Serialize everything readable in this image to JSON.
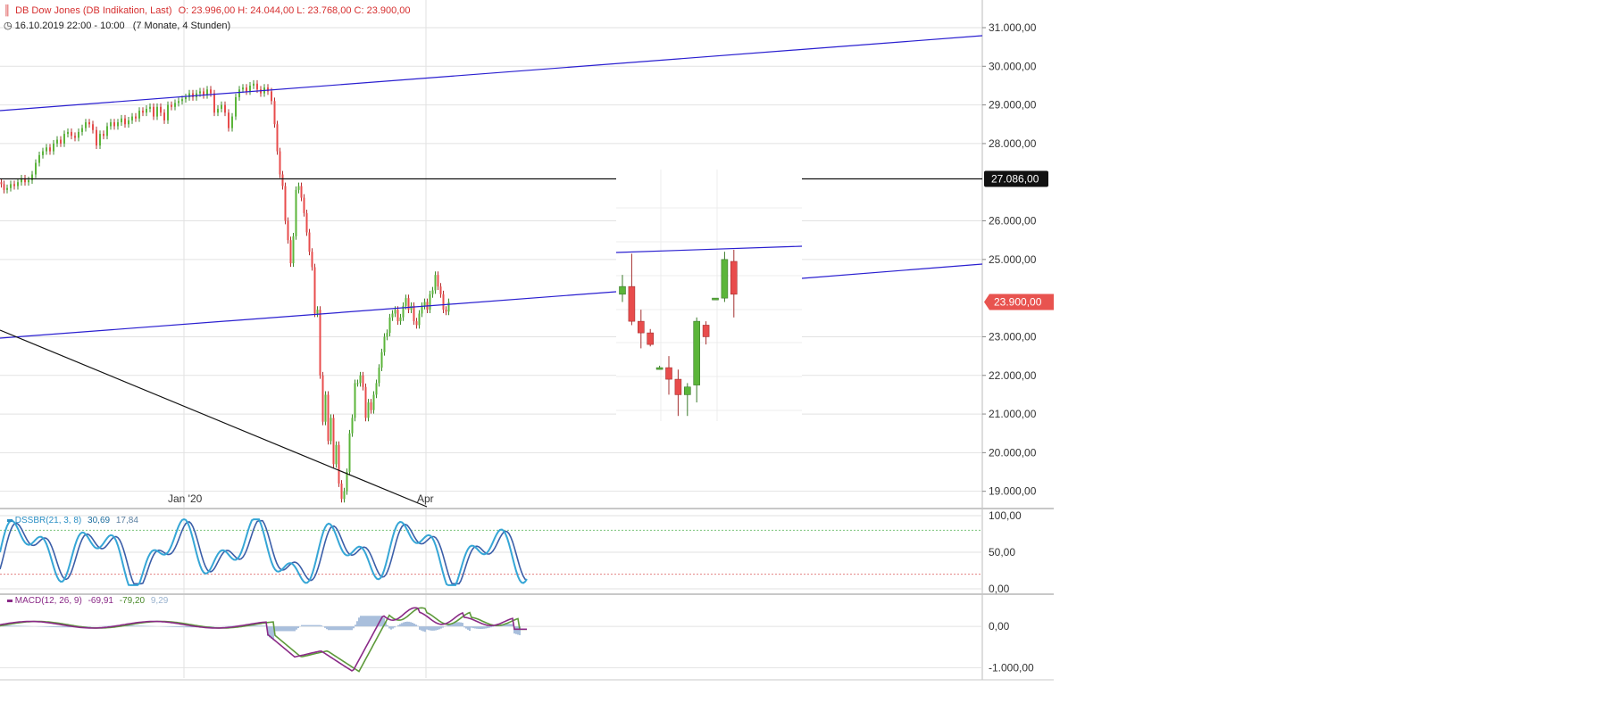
{
  "header": {
    "title": "DB Dow Jones (DB Indikation, Last)",
    "ohlc": "O: 23.996,00   H: 24.044,00   L: 23.768,00   C: 23.900,00",
    "period": "16.10.2019 22:00 - 10:00",
    "range": "(7 Monate, 4 Stunden)"
  },
  "colors": {
    "up": "#5bb53a",
    "down": "#e84c4c",
    "trend": "#2a1fd0",
    "grid": "#e2e2e2",
    "axis": "#333333",
    "last_badge": "#e8534f"
  },
  "icons": [
    "candles-icon",
    "clock-icon"
  ],
  "chart_data": [
    {
      "type": "candlestick",
      "name": "main",
      "x_ticks": [
        "Jan '20",
        "Apr"
      ],
      "y_ticks": [
        "31.000,00",
        "30.000,00",
        "29.000,00",
        "28.000,00",
        "27.086,00",
        "26.000,00",
        "25.000,00",
        "23.900,00",
        "23.000,00",
        "22.000,00",
        "21.000,00",
        "20.000,00",
        "19.000,00"
      ],
      "ylim": [
        18600,
        31300
      ],
      "series_path": [
        [
          0,
          27000
        ],
        [
          3,
          26950
        ],
        [
          6,
          26800
        ],
        [
          10,
          26850
        ],
        [
          14,
          26950
        ],
        [
          18,
          26900
        ],
        [
          22,
          27000
        ],
        [
          26,
          27100
        ],
        [
          30,
          27000
        ],
        [
          34,
          27050
        ],
        [
          38,
          27200
        ],
        [
          42,
          27500
        ],
        [
          46,
          27700
        ],
        [
          50,
          27800
        ],
        [
          54,
          27900
        ],
        [
          58,
          27800
        ],
        [
          62,
          28000
        ],
        [
          66,
          28100
        ],
        [
          70,
          28000
        ],
        [
          74,
          28250
        ],
        [
          78,
          28300
        ],
        [
          82,
          28200
        ],
        [
          86,
          28150
        ],
        [
          90,
          28300
        ],
        [
          94,
          28400
        ],
        [
          98,
          28550
        ],
        [
          102,
          28500
        ],
        [
          106,
          28350
        ],
        [
          110,
          27950
        ],
        [
          114,
          28250
        ],
        [
          118,
          28200
        ],
        [
          122,
          28450
        ],
        [
          126,
          28550
        ],
        [
          130,
          28450
        ],
        [
          134,
          28550
        ],
        [
          138,
          28650
        ],
        [
          142,
          28500
        ],
        [
          146,
          28600
        ],
        [
          150,
          28700
        ],
        [
          154,
          28650
        ],
        [
          158,
          28850
        ],
        [
          162,
          28800
        ],
        [
          166,
          28900
        ],
        [
          170,
          28950
        ],
        [
          174,
          28700
        ],
        [
          178,
          28950
        ],
        [
          182,
          28800
        ],
        [
          186,
          28600
        ],
        [
          190,
          29000
        ],
        [
          194,
          28950
        ],
        [
          198,
          29050
        ],
        [
          202,
          29100
        ],
        [
          206,
          29150
        ],
        [
          210,
          29200
        ],
        [
          214,
          29300
        ],
        [
          218,
          29200
        ],
        [
          222,
          29300
        ],
        [
          226,
          29350
        ],
        [
          230,
          29250
        ],
        [
          234,
          29400
        ],
        [
          238,
          29300
        ],
        [
          242,
          28800
        ],
        [
          246,
          28900
        ],
        [
          250,
          29000
        ],
        [
          254,
          28800
        ],
        [
          258,
          28400
        ],
        [
          262,
          28700
        ],
        [
          266,
          29200
        ],
        [
          270,
          29400
        ],
        [
          274,
          29450
        ],
        [
          278,
          29350
        ],
        [
          282,
          29500
        ],
        [
          286,
          29550
        ],
        [
          290,
          29400
        ],
        [
          294,
          29300
        ],
        [
          298,
          29450
        ],
        [
          302,
          29350
        ],
        [
          306,
          29100
        ],
        [
          309,
          28500
        ],
        [
          312,
          27800
        ],
        [
          315,
          27200
        ],
        [
          318,
          26900
        ],
        [
          321,
          26000
        ],
        [
          324,
          25500
        ],
        [
          327,
          24900
        ],
        [
          330,
          25600
        ],
        [
          333,
          26800
        ],
        [
          336,
          26900
        ],
        [
          339,
          26600
        ],
        [
          342,
          26200
        ],
        [
          345,
          25700
        ],
        [
          348,
          25200
        ],
        [
          351,
          24800
        ],
        [
          354,
          23600
        ],
        [
          357,
          23700
        ],
        [
          360,
          22000
        ],
        [
          363,
          20800
        ],
        [
          366,
          21500
        ],
        [
          369,
          20300
        ],
        [
          372,
          20900
        ],
        [
          375,
          19700
        ],
        [
          378,
          20200
        ],
        [
          381,
          19200
        ],
        [
          384,
          18800
        ],
        [
          387,
          19000
        ],
        [
          390,
          19500
        ],
        [
          393,
          20500
        ],
        [
          396,
          20900
        ],
        [
          399,
          21800
        ],
        [
          402,
          21800
        ],
        [
          405,
          22000
        ],
        [
          408,
          21700
        ],
        [
          411,
          20900
        ],
        [
          414,
          21300
        ],
        [
          417,
          21100
        ],
        [
          420,
          21500
        ],
        [
          423,
          21800
        ],
        [
          426,
          22200
        ],
        [
          429,
          22600
        ],
        [
          432,
          23000
        ],
        [
          435,
          23100
        ],
        [
          438,
          23500
        ],
        [
          441,
          23600
        ],
        [
          444,
          23700
        ],
        [
          447,
          23400
        ],
        [
          450,
          23500
        ],
        [
          453,
          23800
        ],
        [
          456,
          24000
        ],
        [
          459,
          23700
        ],
        [
          462,
          23800
        ],
        [
          465,
          23400
        ],
        [
          468,
          23300
        ],
        [
          471,
          23600
        ],
        [
          474,
          23800
        ],
        [
          477,
          23900
        ],
        [
          480,
          23700
        ],
        [
          483,
          24100
        ],
        [
          486,
          24200
        ],
        [
          489,
          24600
        ],
        [
          492,
          24300
        ],
        [
          495,
          24100
        ],
        [
          498,
          23700
        ],
        [
          501,
          23650
        ],
        [
          504,
          23900
        ]
      ],
      "zoom_candles": [
        {
          "o": 24100,
          "h": 24600,
          "l": 23900,
          "c": 24300
        },
        {
          "o": 24300,
          "h": 25150,
          "l": 23300,
          "c": 23400
        },
        {
          "o": 23400,
          "h": 23700,
          "l": 22700,
          "c": 23100
        },
        {
          "o": 23100,
          "h": 23200,
          "l": 22750,
          "c": 22800
        },
        {
          "o": 22200,
          "h": 22250,
          "l": 22150,
          "c": 22200
        },
        {
          "o": 22200,
          "h": 22500,
          "l": 21500,
          "c": 21900
        },
        {
          "o": 21900,
          "h": 22150,
          "l": 20950,
          "c": 21500
        },
        {
          "o": 21500,
          "h": 21800,
          "l": 20950,
          "c": 21700
        },
        {
          "o": 21750,
          "h": 23500,
          "l": 21300,
          "c": 23400
        },
        {
          "o": 23300,
          "h": 23400,
          "l": 22800,
          "c": 23000
        },
        {
          "o": 24000,
          "h": 24000,
          "l": 23950,
          "c": 24000
        },
        {
          "o": 24000,
          "h": 25200,
          "l": 23900,
          "c": 25000
        },
        {
          "o": 24950,
          "h": 25250,
          "l": 23500,
          "c": 24100
        }
      ],
      "horizontal_level": "27.086,00",
      "last_price": "23.900,00"
    },
    {
      "type": "line",
      "name": "DSSBR",
      "label": "DSSBR(21, 3, 8)",
      "values": [
        "30,69",
        "17,84"
      ],
      "y_ticks": [
        "100,00",
        "50,00",
        "0,00"
      ],
      "ylim": [
        0,
        100
      ],
      "levels": [
        80,
        20
      ]
    },
    {
      "type": "line",
      "name": "MACD",
      "label": "MACD(12, 26, 9)",
      "values": [
        "-69,91",
        "-79,20",
        "9,29"
      ],
      "y_ticks": [
        "0,00",
        "-1.000,00"
      ],
      "ylim": [
        -1250,
        650
      ]
    }
  ]
}
